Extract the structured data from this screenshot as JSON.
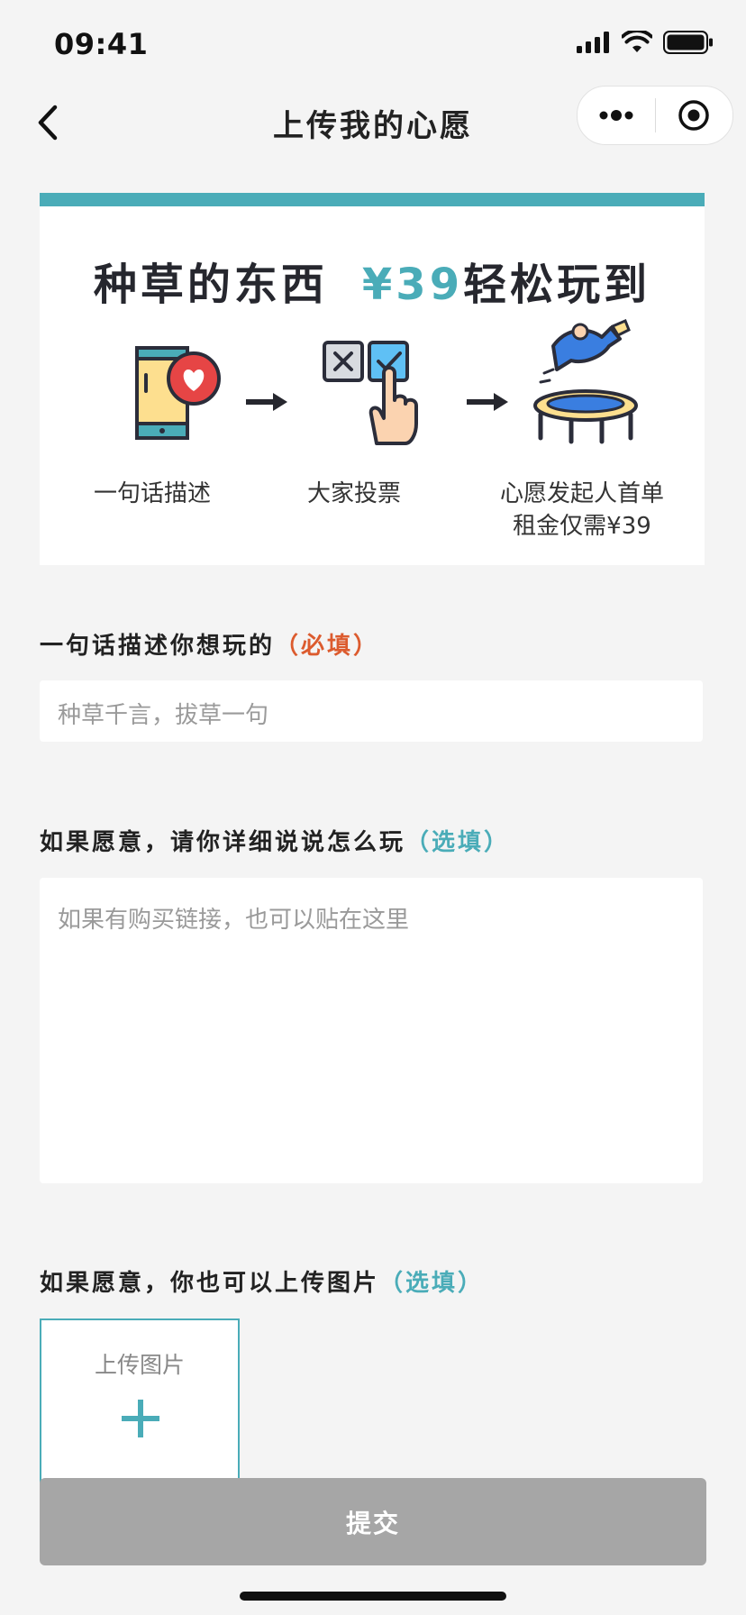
{
  "status_bar": {
    "time": "09:41"
  },
  "nav": {
    "title": "上传我的心愿"
  },
  "banner": {
    "title_main": "种草的东西",
    "title_price": "¥39",
    "title_tail": "轻松玩到",
    "steps": [
      {
        "label": "一句话描述"
      },
      {
        "label": "大家投票"
      },
      {
        "label_line1": "心愿发起人首单",
        "label_line2": "租金仅需¥39"
      }
    ]
  },
  "form": {
    "desc": {
      "label": "一句话描述你想玩的",
      "tag": "（必填）",
      "placeholder": "种草千言，拔草一句"
    },
    "detail": {
      "label": "如果愿意，请你详细说说怎么玩",
      "tag": "（选填）",
      "placeholder": "如果有购买链接，也可以贴在这里"
    },
    "images": {
      "label": "如果愿意，你也可以上传图片",
      "tag": "（选填）",
      "upload_label": "上传图片"
    }
  },
  "submit": {
    "label": "提交"
  },
  "colors": {
    "accent": "#4aacb8",
    "required": "#dc5b2e",
    "submit_bg": "#a6a6a6",
    "page_bg": "#f4f4f4"
  }
}
